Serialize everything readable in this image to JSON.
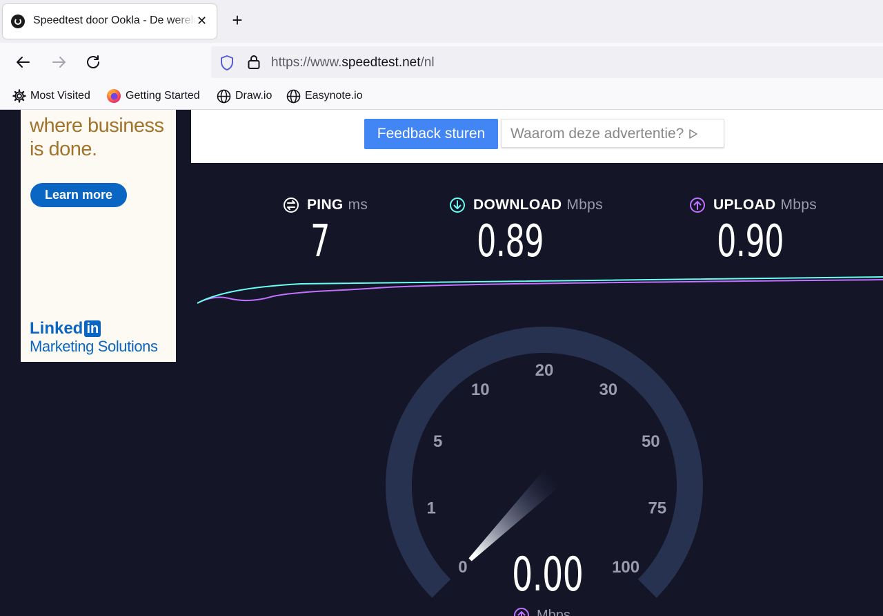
{
  "browser": {
    "tab": {
      "title": "Speedtest door Ookla - De wereldwijde snelheidstest voor breedband",
      "close": "✕"
    },
    "new_tab": "+",
    "url": {
      "prefix": "https://www.",
      "domain": "speedtest.net",
      "path": "/nl"
    },
    "bookmarks": [
      {
        "label": "Most Visited",
        "icon": "gear-icon"
      },
      {
        "label": "Getting Started",
        "icon": "firefox-icon"
      },
      {
        "label": "Draw.io",
        "icon": "globe-icon"
      },
      {
        "label": "Easynote.io",
        "icon": "globe-icon"
      }
    ]
  },
  "ad_left": {
    "tagline": "where business is done.",
    "button": "Learn more",
    "brand_top": "Linked",
    "brand_in": "in",
    "brand_bottom": "Marketing Solutions"
  },
  "ad_top": {
    "feedback_button": "Feedback sturen",
    "why_button": "Waarom deze advertentie?"
  },
  "metrics": {
    "ping": {
      "label": "PING",
      "unit": "ms",
      "value": "7",
      "color": "#ffffff"
    },
    "download": {
      "label": "DOWNLOAD",
      "unit": "Mbps",
      "value": "0.89",
      "color": "#6afff3"
    },
    "upload": {
      "label": "UPLOAD",
      "unit": "Mbps",
      "value": "0.90",
      "color": "#bf71ff"
    }
  },
  "gauge": {
    "ticks": [
      "0",
      "1",
      "5",
      "10",
      "20",
      "30",
      "50",
      "75",
      "100"
    ],
    "value": "0.00",
    "unit": "Mbps",
    "needle_value": 0
  },
  "colors": {
    "background": "#141526",
    "download": "#6afff3",
    "upload": "#bf71ff",
    "feedback": "#4285f4",
    "linkedin": "#0a66c2"
  }
}
